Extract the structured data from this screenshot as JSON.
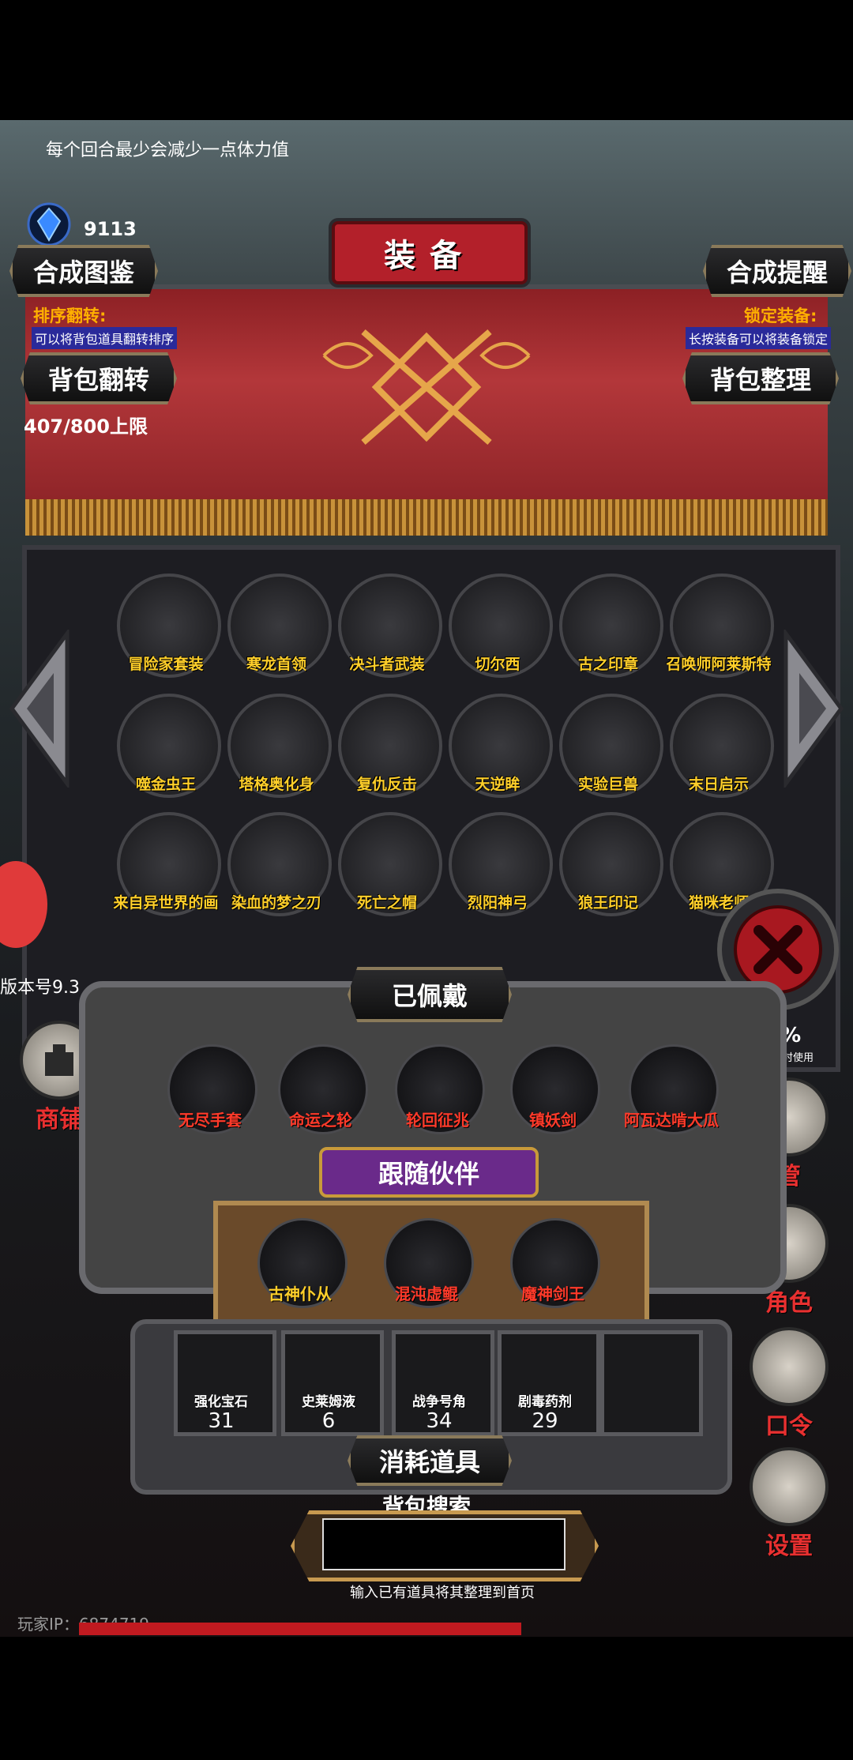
{
  "tip": "每个回合最少会减少一点体力值",
  "gems": "9113",
  "title": "装备",
  "top_buttons": {
    "left": "合成图鉴",
    "right": "合成提醒",
    "flip": "背包翻转",
    "sort": "背包整理"
  },
  "hints": {
    "sort_flip_title": "排序翻转:",
    "sort_flip_desc": "可以将背包道具翻转排序",
    "lock_title": "锁定装备:",
    "lock_desc": "长按装备可以将装备锁定"
  },
  "capacity": "407/800上限",
  "inventory": [
    {
      "label": "冒险家套装"
    },
    {
      "label": "寒龙首领"
    },
    {
      "label": "决斗者武装"
    },
    {
      "label": "切尔西"
    },
    {
      "label": "古之印章"
    },
    {
      "label": "召唤师阿莱斯特"
    },
    {
      "label": "噬金虫王"
    },
    {
      "label": "塔格奥化身"
    },
    {
      "label": "复仇反击"
    },
    {
      "label": "天逆眸"
    },
    {
      "label": "实验巨兽"
    },
    {
      "label": "末日启示"
    },
    {
      "label": "来自异世界的画"
    },
    {
      "label": "染血的梦之刃"
    },
    {
      "label": "死亡之帽"
    },
    {
      "label": "烈阳神弓"
    },
    {
      "label": "狼王印记"
    },
    {
      "label": "猫咪老师"
    }
  ],
  "version": "版本号9.3",
  "shop_label": "商铺",
  "side_buttons": [
    "管",
    "角色",
    "口令",
    "设置"
  ],
  "side_tag": {
    "value": "30%",
    "desc": "其数值时使用"
  },
  "equipped_title": "已佩戴",
  "equipped": [
    {
      "label": "无尽手套"
    },
    {
      "label": "命运之轮"
    },
    {
      "label": "轮回征兆"
    },
    {
      "label": "镇妖剑"
    },
    {
      "label": "阿瓦达啃大瓜"
    }
  ],
  "companion_title": "跟随伙伴",
  "companions": [
    {
      "label": "古神仆从"
    },
    {
      "label": "混沌虚鲲"
    },
    {
      "label": "魔神剑王"
    }
  ],
  "consumables": [
    {
      "label": "强化宝石",
      "count": "31"
    },
    {
      "label": "史莱姆液",
      "count": "6"
    },
    {
      "label": "战争号角",
      "count": "34"
    },
    {
      "label": "剧毒药剂",
      "count": "29"
    }
  ],
  "consumables_title": "消耗道具",
  "search": {
    "title": "背包搜索",
    "hint": "输入已有道具将其整理到首页"
  },
  "player_id": "玩家IP：6874719"
}
